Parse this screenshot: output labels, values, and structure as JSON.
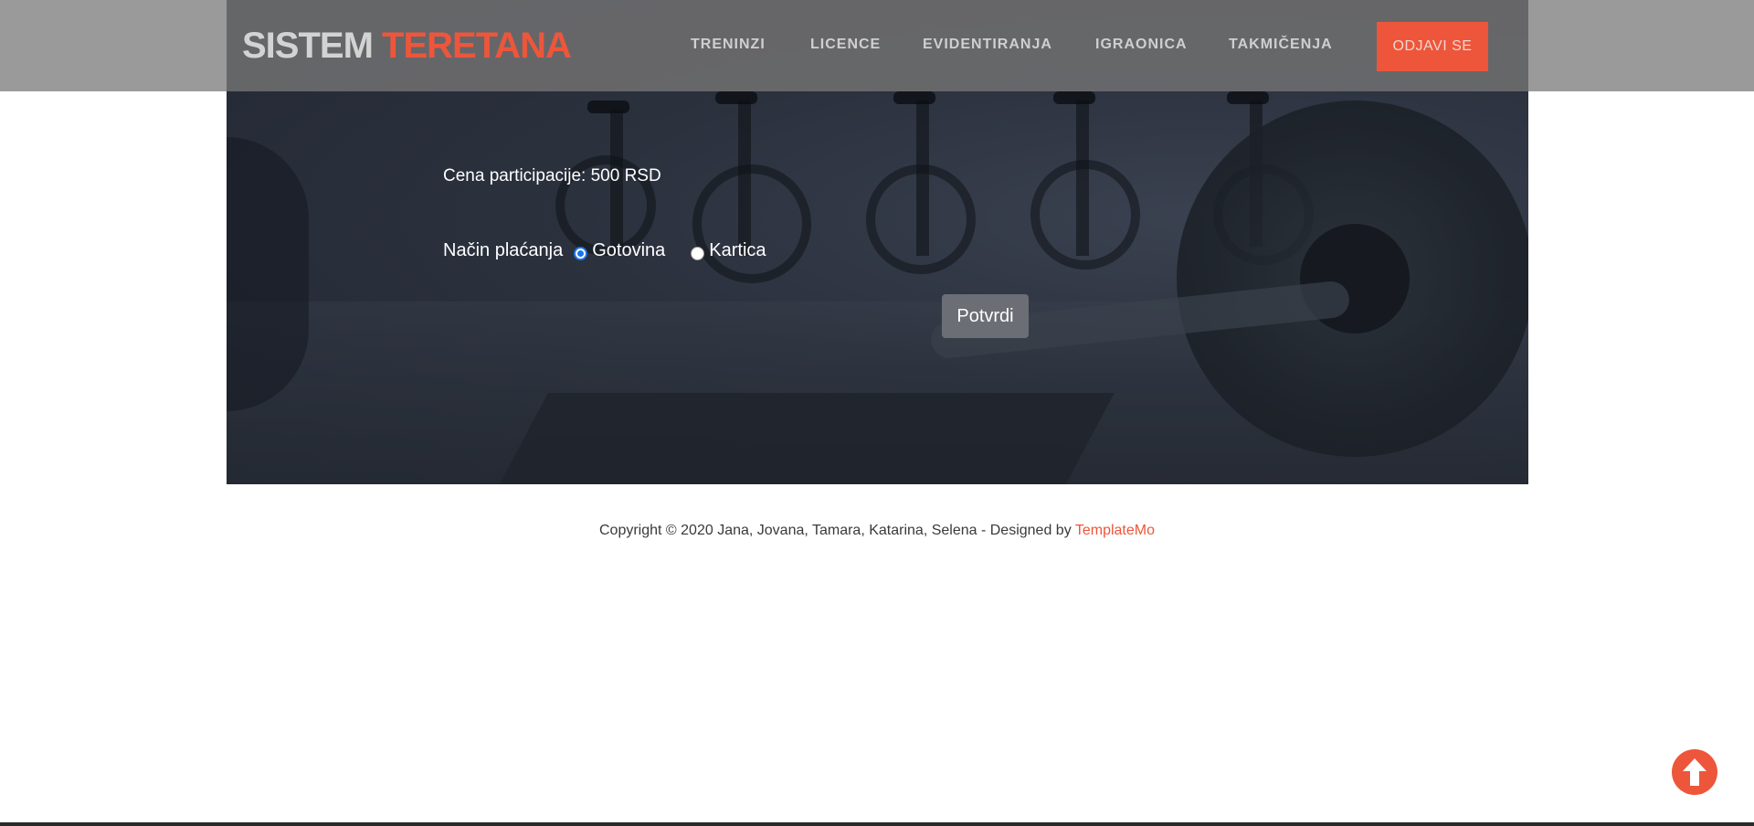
{
  "header": {
    "logo_part1": "SISTEM",
    "logo_part2": "TERETANA",
    "nav": [
      "TRENINZI",
      "LICENCE",
      "EVIDENTIRANJA",
      "IGRAONICA",
      "TAKMIČENJA"
    ],
    "logout_label": "ODJAVI SE"
  },
  "form": {
    "price_text": "Cena participacije: 500 RSD",
    "payment_label": "Način plaćanja",
    "options": [
      {
        "label": "Gotovina",
        "checked": true
      },
      {
        "label": "Kartica",
        "checked": false
      }
    ],
    "submit_label": "Potvrdi"
  },
  "footer": {
    "text": "Copyright © 2020 Jana, Jovana, Tamara, Katarina, Selena - Designed by",
    "link": "TemplateMo"
  },
  "colors": {
    "accent": "#ed563b",
    "radio_checked": "#1a73e8"
  },
  "icons": {
    "scroll_top": "arrow-up-circle-icon"
  }
}
